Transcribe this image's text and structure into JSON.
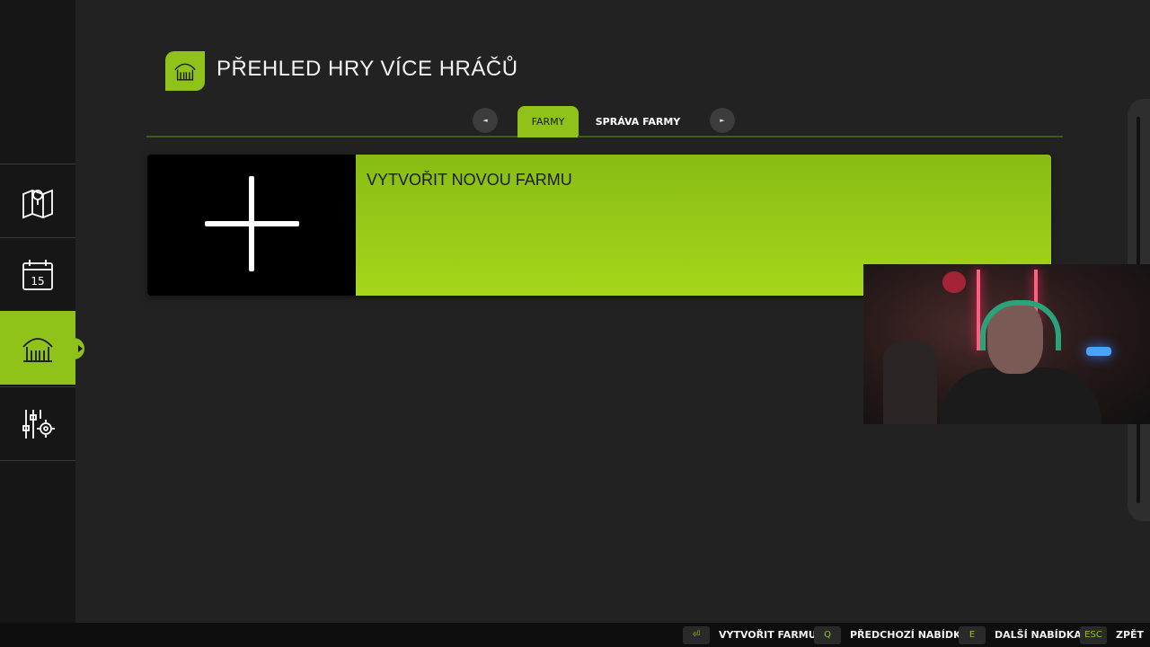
{
  "header": {
    "title": "PŘEHLED HRY VÍCE HRÁČŮ",
    "icon": "farm-icon"
  },
  "sidebar": {
    "items": [
      {
        "name": "map",
        "icon": "map-icon",
        "active": false
      },
      {
        "name": "calendar",
        "icon": "calendar-icon",
        "icon_text": "15",
        "active": false
      },
      {
        "name": "farms",
        "icon": "farm-icon",
        "active": true
      },
      {
        "name": "settings",
        "icon": "settings-sliders-icon",
        "active": false
      }
    ]
  },
  "tabs": {
    "prev_glyph": "◄",
    "next_glyph": "►",
    "items": [
      {
        "label": "FARMY",
        "active": true
      },
      {
        "label": "SPRÁVA FARMY",
        "active": false
      }
    ]
  },
  "farm_list": {
    "items": [
      {
        "label": "VYTVOŘIT NOVOU FARMU",
        "icon": "plus-icon"
      }
    ]
  },
  "footer": {
    "hints": [
      {
        "key": "⏎",
        "label": "VYTVOŘIT FARMU"
      },
      {
        "key": "Q",
        "label": "PŘEDCHOZÍ NABÍDKA"
      },
      {
        "key": "E",
        "label": "DALŠÍ NABÍDKA"
      },
      {
        "key": "ESC",
        "label": "ZPĚT"
      }
    ]
  },
  "colors": {
    "accent": "#8fc31a",
    "background": "#222222",
    "sidebar": "#161616"
  }
}
